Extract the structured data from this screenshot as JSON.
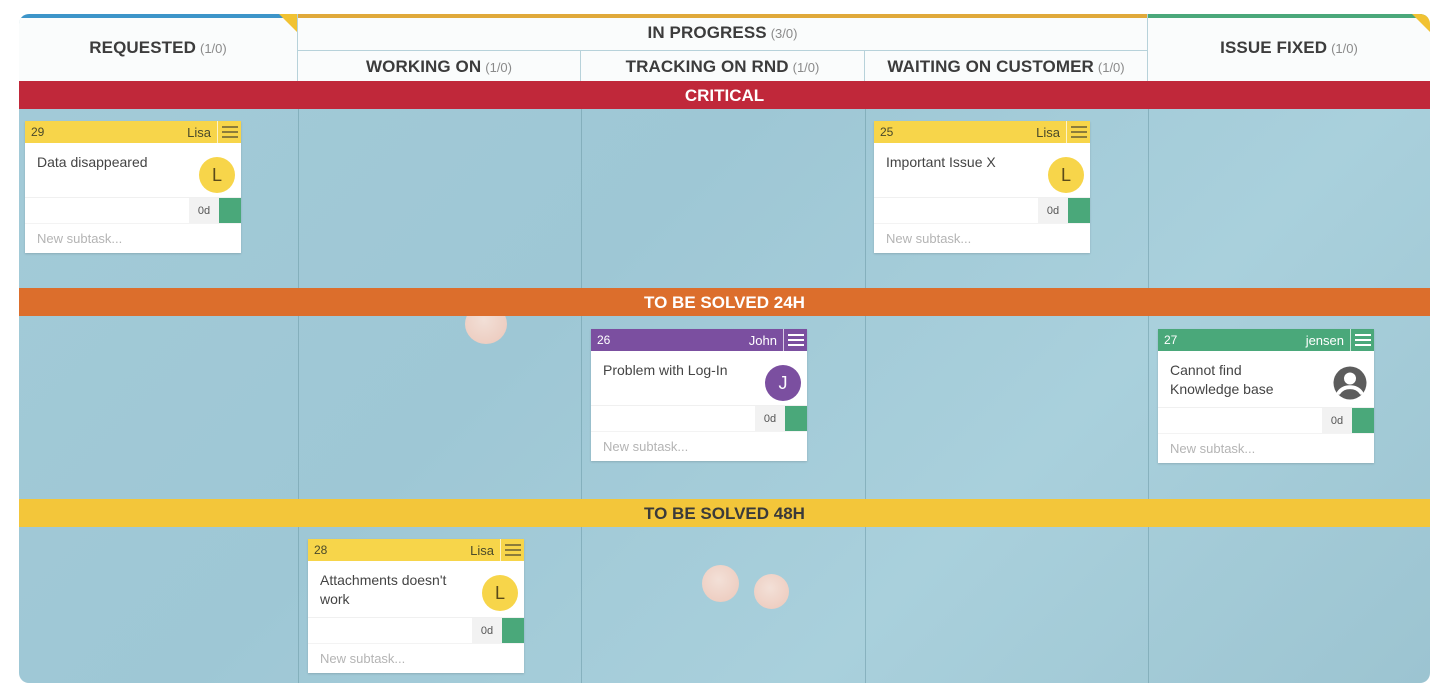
{
  "columns": {
    "requested": {
      "label": "REQUESTED",
      "count": "(1/0)",
      "accent": "#3d95c9"
    },
    "in_progress": {
      "label": "IN PROGRESS",
      "count": "(3/0)",
      "accent": "#e0a93a"
    },
    "working_on": {
      "label": "WORKING ON",
      "count": "(1/0)"
    },
    "tracking_on_rnd": {
      "label": "TRACKING ON RND",
      "count": "(1/0)"
    },
    "waiting_on_customer": {
      "label": "WAITING ON CUSTOMER",
      "count": "(1/0)"
    },
    "issue_fixed": {
      "label": "ISSUE FIXED",
      "count": "(1/0)",
      "accent": "#4aa87a"
    }
  },
  "lanes": [
    {
      "label": "CRITICAL",
      "color": "#c0283a"
    },
    {
      "label": "TO BE SOLVED 24H",
      "color": "#dc6e2c"
    },
    {
      "label": "TO BE SOLVED 48H",
      "color": "#f3c63a"
    }
  ],
  "cards": [
    {
      "id": "29",
      "owner": "Lisa",
      "title": "Data disappeared",
      "avatar": "L",
      "days": "0d",
      "new_subtask": "New subtask...",
      "color": "#f7d54a"
    },
    {
      "id": "25",
      "owner": "Lisa",
      "title": "Important Issue X",
      "avatar": "L",
      "days": "0d",
      "new_subtask": "New subtask...",
      "color": "#f7d54a"
    },
    {
      "id": "26",
      "owner": "John",
      "title": "Problem with Log-In",
      "avatar": "J",
      "days": "0d",
      "new_subtask": "New subtask...",
      "color": "#7b4fa0"
    },
    {
      "id": "27",
      "owner": "jensen",
      "title": "Cannot find Knowledge base",
      "avatar": "person-icon",
      "days": "0d",
      "new_subtask": "New subtask...",
      "color": "#4aa87a"
    },
    {
      "id": "28",
      "owner": "Lisa",
      "title": "Attachments doesn't work",
      "avatar": "L",
      "days": "0d",
      "new_subtask": "New subtask...",
      "color": "#f7d54a"
    }
  ]
}
